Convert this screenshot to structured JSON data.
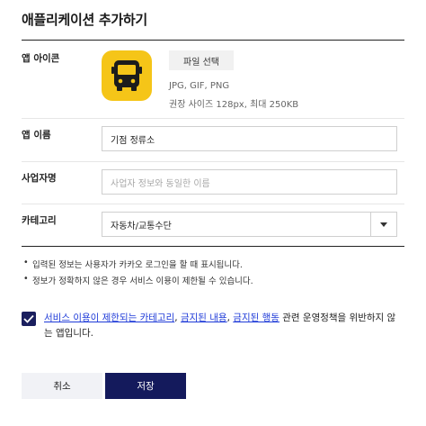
{
  "page": {
    "title": "애플리케이션 추가하기"
  },
  "form": {
    "icon": {
      "label": "앱 아이콘",
      "icon_name": "bus-icon",
      "icon_bg_color": "#f5c518",
      "file_button": "파일 선택",
      "formats": "JPG, GIF, PNG",
      "size_hint": "권장 사이즈 128px, 최대 250KB"
    },
    "app_name": {
      "label": "앱 이름",
      "value": "기점 정류소"
    },
    "company": {
      "label": "사업자명",
      "placeholder": "사업자 정보와 동일한 이름"
    },
    "category": {
      "label": "카테고리",
      "selected": "자동차/교통수단"
    }
  },
  "notes": [
    "입력된 정보는 사용자가 카카오 로그인을 할 때 표시됩니다.",
    "정보가 정확하지 않은 경우 서비스 이용이 제한될 수 있습니다."
  ],
  "agreement": {
    "checked": true,
    "link1": "서비스 이용이 제한되는 카테고리",
    "sep1": ", ",
    "link2": "금지된 내용",
    "sep2": ", ",
    "link3": "금지된 행동",
    "rest": " 관련 운영정책을 위반하지 않는 앱입니다."
  },
  "buttons": {
    "cancel": "취소",
    "save": "저장"
  },
  "colors": {
    "primary": "#141a5c",
    "link": "#1f3bd8",
    "icon_yellow": "#f5c518"
  }
}
